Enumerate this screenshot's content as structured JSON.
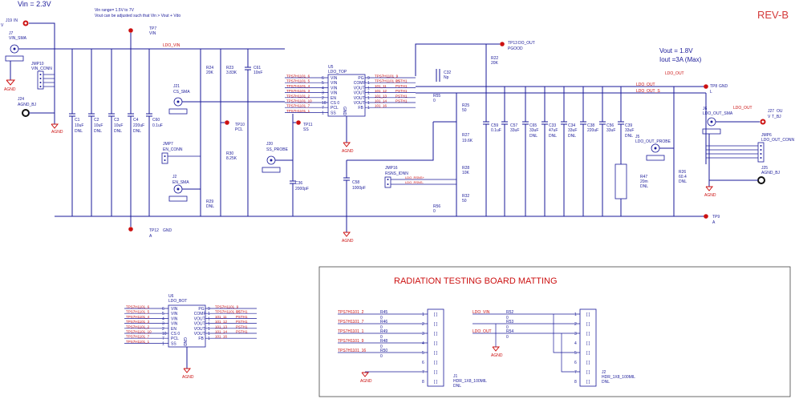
{
  "header": {
    "vin_title": "Vin = 2.3V",
    "vin_range_1": "Vin range= 1.5V to 7V",
    "vin_range_2": "Vout can be adjusted such that  Vin > Vout + Vdo",
    "rev": "REV-B",
    "vout_1": "Vout = 1.8V",
    "vout_2": "Iout =3A (Max)"
  },
  "nets": {
    "ldo_vin": "LDO_VIN",
    "ldo_out": "LDO_OUT",
    "ldo_out_s": "LDO_OUT_S",
    "agnd": "AGND",
    "gnd": "GND"
  },
  "connectors": {
    "j19": "J19",
    "j19_pin": "IN",
    "j7": "J7",
    "j7_label": "VIN_SMA",
    "jmp10": "JMP10",
    "jmp10_label": "VIN_CONN",
    "j24": "J24",
    "j24_label": "AGND_BJ",
    "j21": "J21",
    "j21_label": "CS_SMA",
    "jmp7": "JMP7",
    "jmp7_label": "EN_CONN",
    "j2": "J2",
    "j2_label": "EN_SMA",
    "j20": "J20",
    "j20_label": "SS_PROBE",
    "jmp16": "JMP16",
    "jmp16_label": "RSNS_IDNN",
    "j5": "J5",
    "j5_label": "LDO_OUT_PROBE",
    "j6": "J6",
    "j6_label": "LDO_OUT_SMA",
    "j27": "J27",
    "j27_label": "T_BJ",
    "j27_out": "OU",
    "jmp6": "JMP6",
    "jmp6_label": "LDO_OUT_CONN",
    "j25": "J25",
    "j25_label": "AGND_BJ"
  },
  "testpoints": {
    "tp7": "TP7",
    "tp7_label": "VIN",
    "tp10": "TP10",
    "tp10_label": "PCL",
    "tp11": "TP11",
    "tp11_label": "SS",
    "tp12": "TP12",
    "tp12_label": "GND",
    "tp13": "TP13",
    "tp13_label": "DO_OUT",
    "tp13_sub": "PGOOD",
    "tp8": "TP8",
    "tp8_label": "GND",
    "tp9": "TP9"
  },
  "capacitors": [
    {
      "ref": "C1",
      "val": "10uF",
      "note": "DNL"
    },
    {
      "ref": "C2",
      "val": "10uF",
      "note": "DNL"
    },
    {
      "ref": "C3",
      "val": "10uF",
      "note": "DNL"
    },
    {
      "ref": "C4",
      "val": "220uF",
      "note": "DNL"
    },
    {
      "ref": "C60",
      "val": "0.1uF",
      "note": ""
    },
    {
      "ref": "C61",
      "val": "10nF",
      "note": ""
    },
    {
      "ref": "C36",
      "val": "2000pF",
      "note": ""
    },
    {
      "ref": "C58",
      "val": "1000pF",
      "note": ""
    },
    {
      "ref": "C32",
      "val": "Np",
      "note": ""
    },
    {
      "ref": "C59",
      "val": "0.1uF",
      "note": ""
    },
    {
      "ref": "C57",
      "val": "33uF",
      "note": ""
    },
    {
      "ref": "C65",
      "val": "33uF",
      "note": "DNL"
    },
    {
      "ref": "C33",
      "val": "47uF",
      "note": "DNL"
    },
    {
      "ref": "C34",
      "val": "33uF",
      "note": "DNL"
    },
    {
      "ref": "C38",
      "val": "220uF",
      "note": ""
    },
    {
      "ref": "C56",
      "val": "33uF",
      "note": ""
    },
    {
      "ref": "C39",
      "val": "33uF",
      "note": "DNL"
    }
  ],
  "resistors": [
    {
      "ref": "R24",
      "val": "20K"
    },
    {
      "ref": "R23",
      "val": "3.83K"
    },
    {
      "ref": "R30",
      "val": "8.25K"
    },
    {
      "ref": "R29",
      "val": "DNL"
    },
    {
      "ref": "R22",
      "val": "20K"
    },
    {
      "ref": "R55",
      "val": "0"
    },
    {
      "ref": "R25",
      "val": "50"
    },
    {
      "ref": "R27",
      "val": "19.6K"
    },
    {
      "ref": "R28",
      "val": "10K"
    },
    {
      "ref": "R32",
      "val": "50"
    },
    {
      "ref": "R56",
      "val": "0"
    },
    {
      "ref": "R47",
      "val": "20m"
    },
    {
      "ref": "R47_note",
      "val": "DNL"
    },
    {
      "ref": "R26",
      "val": "60.4"
    },
    {
      "ref": "R26_note",
      "val": "DNL"
    }
  ],
  "u5": {
    "ref": "U5",
    "name": "LDO_TOP",
    "left_pins": [
      "VIN",
      "VIN",
      "VIN",
      "VIN",
      "EN",
      "CS 0",
      "PCL",
      "SS"
    ],
    "left_nums": [
      "6",
      "5",
      "4",
      "3",
      "2",
      "10",
      "7",
      "1"
    ],
    "right_pins": [
      "PG",
      "COMP",
      "VOUT",
      "VOUT",
      "VOUT",
      "VOUT",
      "FB"
    ],
    "right_nums": [
      "9",
      "1",
      "1",
      "1",
      "1",
      "1",
      "1"
    ],
    "center": "GND",
    "left_nets": [
      "TPS7H1101_6",
      "TPS7H1101_5",
      "TPS7H1101_4",
      "TPS7H1101_3",
      "TPS7H1101_2",
      "TPS7H1101_10",
      "TPS7H1101_7",
      "TPS7H1101_1"
    ],
    "right_nets": [
      "TPS7H1101_9",
      "TPS7H1101_15",
      "101_11",
      "101_12",
      "101_13",
      "101_14",
      "101_16"
    ],
    "right_nets_suffix": [
      "",
      "PSTH1",
      "PSTH1",
      "PSTH1",
      "PSTH1",
      "PSTH1",
      ""
    ]
  },
  "u6": {
    "ref": "U6",
    "name": "LDO_BOT",
    "left_pins": [
      "VIN",
      "VIN",
      "VIN",
      "VIN",
      "EN",
      "CS 0",
      "PCL",
      "SS"
    ],
    "left_nums": [
      "6",
      "5",
      "4",
      "3",
      "2",
      "10",
      "7",
      "1"
    ],
    "right_pins": [
      "PG",
      "COMP",
      "VOUT",
      "VOUT",
      "VOUT",
      "VOUT",
      "FB"
    ],
    "right_nums": [
      "9",
      "1",
      "1",
      "1",
      "1",
      "1",
      "1"
    ],
    "center": "GND",
    "left_nets": [
      "TPS7H1101_6",
      "TPS7H1101_5",
      "TPS7H1101_4",
      "TPS7H1101_3",
      "TPS7H1101_2",
      "TPS7H1101_10",
      "TPS7H1101_7",
      "TPS7H1101_1"
    ],
    "right_nets": [
      "TPS7H1101_9",
      "TPS7H1101_15",
      "101_11",
      "101_12",
      "101_13",
      "101_14",
      "101_16"
    ],
    "right_nets_suffix": [
      "",
      "PSTH1",
      "PSTH1",
      "PSTH1",
      "PSTH1",
      "PSTH1",
      ""
    ]
  },
  "matting": {
    "title": "RADIATION TESTING BOARD MATTING",
    "j1_nets": [
      "TPS7H1101_2",
      "TPS7H1101_7",
      "TPS7H1101_1",
      "TPS7H1101_9",
      "TPS7H1101_16"
    ],
    "j1_res": [
      "R45",
      "R46",
      "R49",
      "R48",
      "R50"
    ],
    "j1_ref": "J1",
    "j1_name": "HDR_1X8_100MIL",
    "j1_note": "DNL",
    "j2_nets": [
      "LDO_VIN",
      "LDO_OUT"
    ],
    "j2_res": [
      "R52",
      "R53",
      "R54"
    ],
    "j2_ref": "J2",
    "j2_name": "HDR_1X8_100MIL",
    "j2_note": "DNL",
    "pins": [
      "1",
      "2",
      "3",
      "4",
      "5",
      "6",
      "7",
      "8"
    ],
    "zero": "0"
  },
  "misc": {
    "rsns_plus": "LDO_RSNS+",
    "rsns_minus": "LDO_RSNS-",
    "gnd_label": "GND",
    "a": "A",
    "v": "V",
    "l": "L"
  },
  "colors": {
    "wire": "#1a1a99",
    "testpoint": "#cc1111",
    "rev": "#d43a3a"
  }
}
